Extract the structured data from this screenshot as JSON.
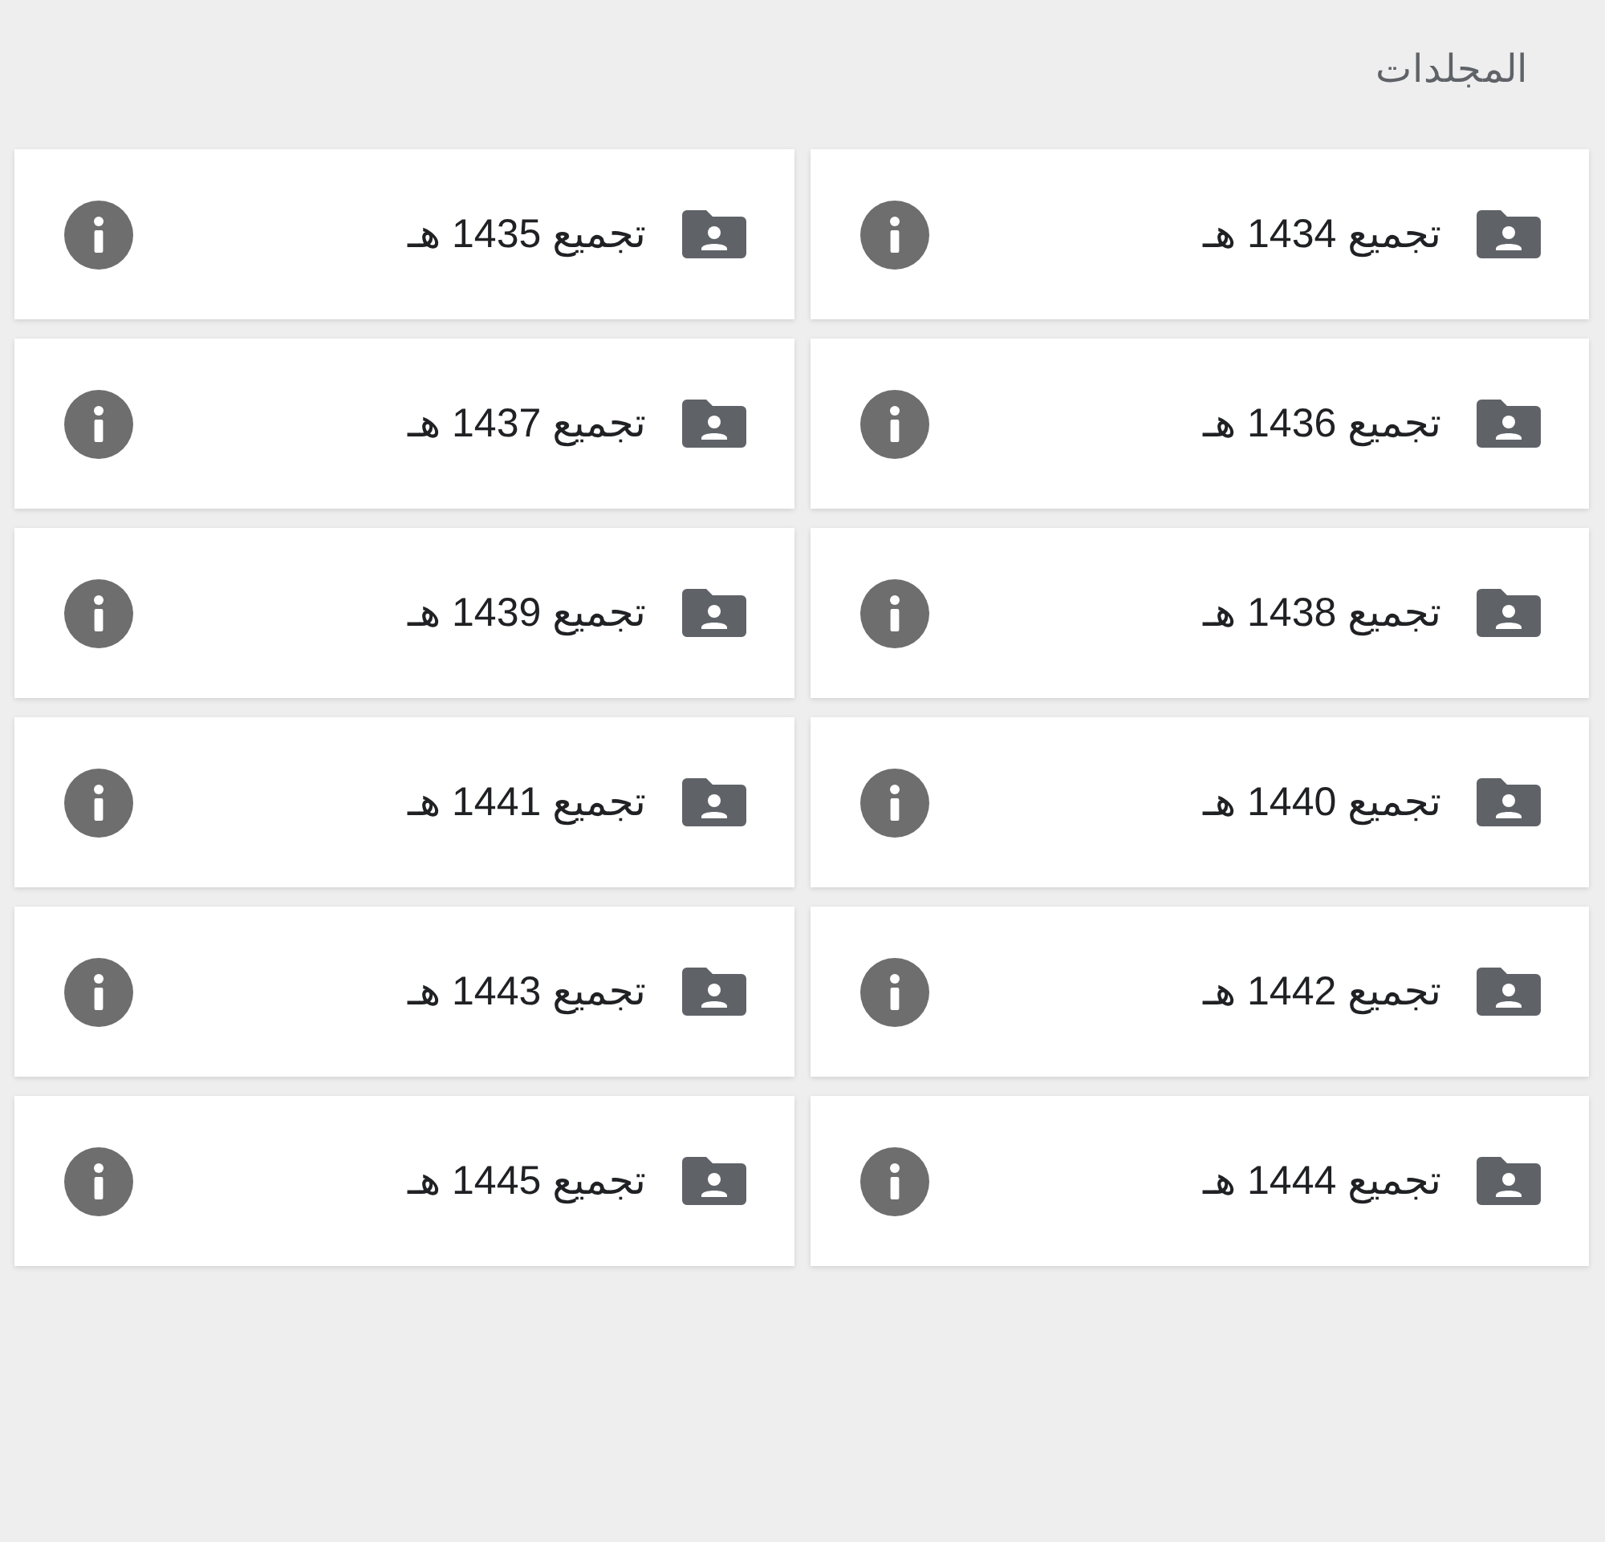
{
  "header": {
    "title": "المجلدات"
  },
  "folders": [
    {
      "name": "تجميع 1434 هـ"
    },
    {
      "name": "تجميع 1435 هـ"
    },
    {
      "name": "تجميع 1436 هـ"
    },
    {
      "name": "تجميع 1437 هـ"
    },
    {
      "name": "تجميع 1438 هـ"
    },
    {
      "name": "تجميع 1439 هـ"
    },
    {
      "name": "تجميع 1440 هـ"
    },
    {
      "name": "تجميع 1441 هـ"
    },
    {
      "name": "تجميع 1442 هـ"
    },
    {
      "name": "تجميع 1443 هـ"
    },
    {
      "name": "تجميع 1444 هـ"
    },
    {
      "name": "تجميع 1445 هـ"
    }
  ]
}
